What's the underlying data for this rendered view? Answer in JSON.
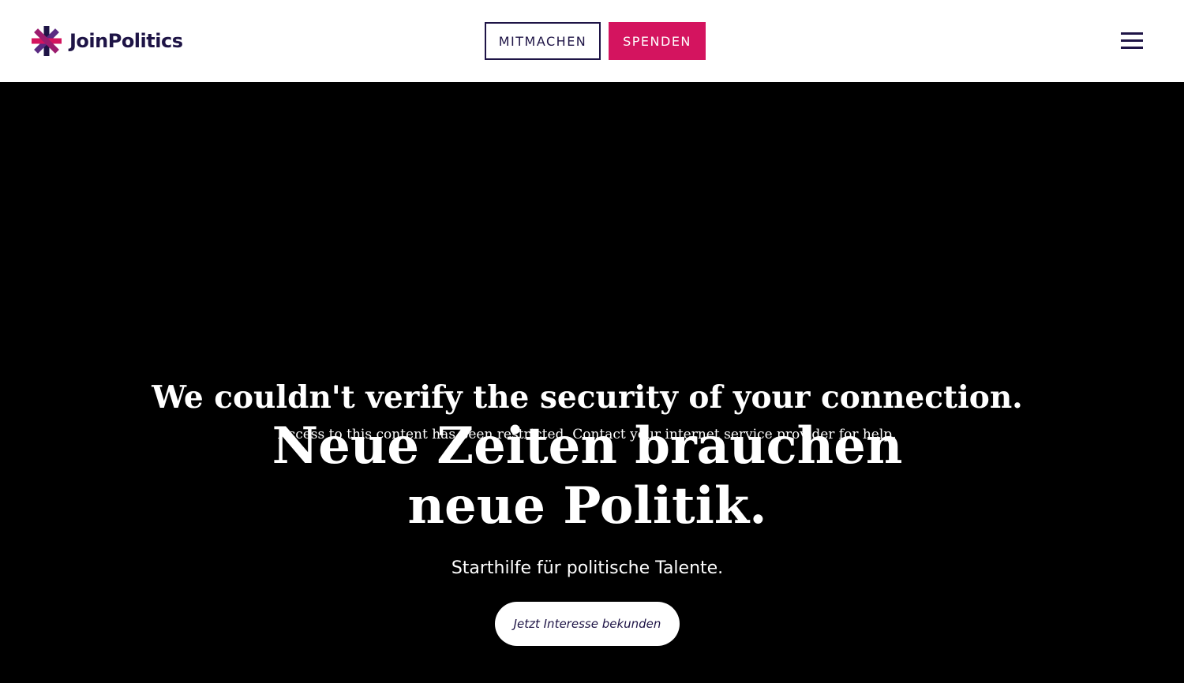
{
  "header": {
    "logo_text": "JoinPolitics",
    "mitmachen_label": "MITMACHEN",
    "spenden_label": "SPENDEN",
    "menu_icon": "hamburger-menu-icon"
  },
  "hero": {
    "title_line1": "Neue Zeiten brauchen",
    "title_line2": "neue Politik.",
    "subtitle": "Starthilfe für politische Talente.",
    "cta_label": "Jetzt Interesse bekunden"
  },
  "overlay": {
    "title": "We couldn't verify the security of your connection.",
    "message": "Access to this content has been restricted. Contact your internet service provider for help."
  },
  "colors": {
    "brand_dark": "#1e1446",
    "brand_pink": "#d4145f",
    "hero_background": "#000000"
  }
}
